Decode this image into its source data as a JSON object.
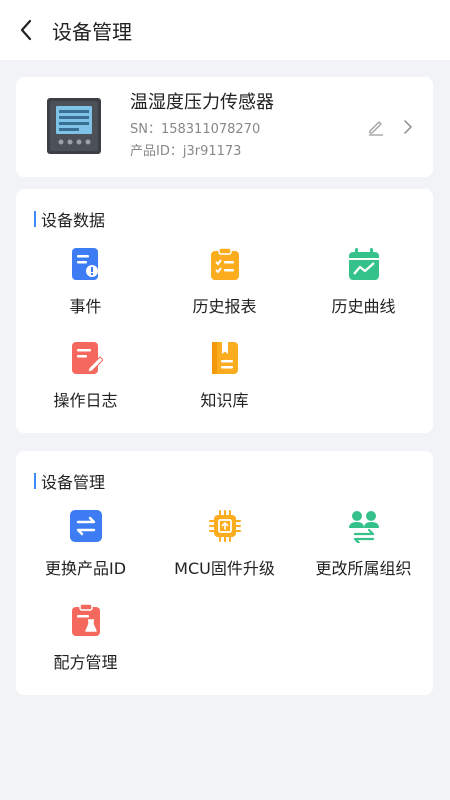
{
  "header": {
    "title": "设备管理"
  },
  "device": {
    "name": "温湿度压力传感器",
    "sn": "SN：158311078270",
    "product_id": "产品ID：j3r91173"
  },
  "data_section": {
    "title": "设备数据",
    "items": [
      {
        "label": "事件",
        "icon": "event-icon"
      },
      {
        "label": "历史报表",
        "icon": "report-icon"
      },
      {
        "label": "历史曲线",
        "icon": "curve-icon"
      },
      {
        "label": "操作日志",
        "icon": "log-icon"
      },
      {
        "label": "知识库",
        "icon": "knowledge-icon"
      }
    ]
  },
  "manage_section": {
    "title": "设备管理",
    "items": [
      {
        "label": "更换产品ID",
        "icon": "swap-icon"
      },
      {
        "label": "MCU固件升级",
        "icon": "chip-icon"
      },
      {
        "label": "更改所属组织",
        "icon": "org-icon"
      },
      {
        "label": "配方管理",
        "icon": "recipe-icon"
      }
    ]
  },
  "colors": {
    "blue": "#3d7cf2",
    "orange": "#fbad1f",
    "green": "#35c28a",
    "red": "#f4685e",
    "accent_bar": "#3d8bfd"
  }
}
